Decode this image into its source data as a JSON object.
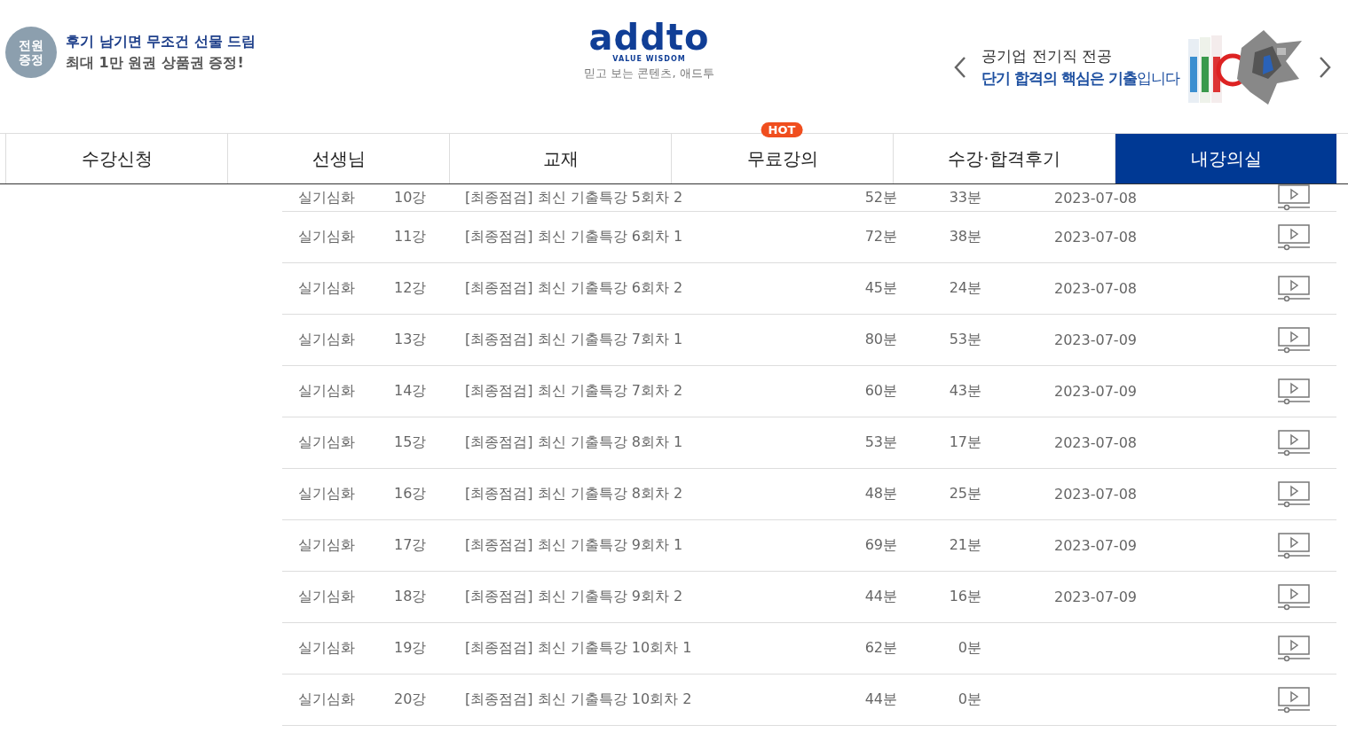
{
  "promo": {
    "badge": "전원\n증정",
    "headline": "후기 남기면 무조건 선물 드림",
    "subline": "최대 1만 원권 상품권 증정!"
  },
  "logo": {
    "wordmark": "addto",
    "tagline": "VALUE WISDOM",
    "slogan": "믿고 보는 콘텐츠, 애드투"
  },
  "banner": {
    "line1": "공기업 전기직 전공",
    "line2_bold": "단기 합격의 핵심은 기출",
    "line2_rest": "입니다"
  },
  "nav": [
    {
      "label": "수강신청",
      "selected": false
    },
    {
      "label": "선생님",
      "selected": false
    },
    {
      "label": "교재",
      "selected": false
    },
    {
      "label": "무료강의",
      "selected": false,
      "badge": "HOT"
    },
    {
      "label": "수강·합격후기",
      "selected": false
    },
    {
      "label": "내강의실",
      "selected": true
    }
  ],
  "lectures": [
    {
      "category": "실기심화",
      "number": "10강",
      "title": "[최종점검] 최신 기출특강 5회차 2",
      "duration": "52분",
      "progress": "33분",
      "date": "2023-07-08"
    },
    {
      "category": "실기심화",
      "number": "11강",
      "title": "[최종점검] 최신 기출특강 6회차 1",
      "duration": "72분",
      "progress": "38분",
      "date": "2023-07-08"
    },
    {
      "category": "실기심화",
      "number": "12강",
      "title": "[최종점검] 최신 기출특강 6회차 2",
      "duration": "45분",
      "progress": "24분",
      "date": "2023-07-08"
    },
    {
      "category": "실기심화",
      "number": "13강",
      "title": "[최종점검] 최신 기출특강 7회차 1",
      "duration": "80분",
      "progress": "53분",
      "date": "2023-07-09"
    },
    {
      "category": "실기심화",
      "number": "14강",
      "title": "[최종점검] 최신 기출특강 7회차 2",
      "duration": "60분",
      "progress": "43분",
      "date": "2023-07-09"
    },
    {
      "category": "실기심화",
      "number": "15강",
      "title": "[최종점검] 최신 기출특강 8회차 1",
      "duration": "53분",
      "progress": "17분",
      "date": "2023-07-08"
    },
    {
      "category": "실기심화",
      "number": "16강",
      "title": "[최종점검] 최신 기출특강 8회차 2",
      "duration": "48분",
      "progress": "25분",
      "date": "2023-07-08"
    },
    {
      "category": "실기심화",
      "number": "17강",
      "title": "[최종점검] 최신 기출특강 9회차 1",
      "duration": "69분",
      "progress": "21분",
      "date": "2023-07-09"
    },
    {
      "category": "실기심화",
      "number": "18강",
      "title": "[최종점검] 최신 기출특강 9회차 2",
      "duration": "44분",
      "progress": "16분",
      "date": "2023-07-09"
    },
    {
      "category": "실기심화",
      "number": "19강",
      "title": "[최종점검] 최신 기출특강 10회차 1",
      "duration": "62분",
      "progress": "0분"
    },
    {
      "category": "실기심화",
      "number": "20강",
      "title": "[최종점검] 최신 기출특강 10회차 2",
      "duration": "44분",
      "progress": "0분"
    }
  ]
}
